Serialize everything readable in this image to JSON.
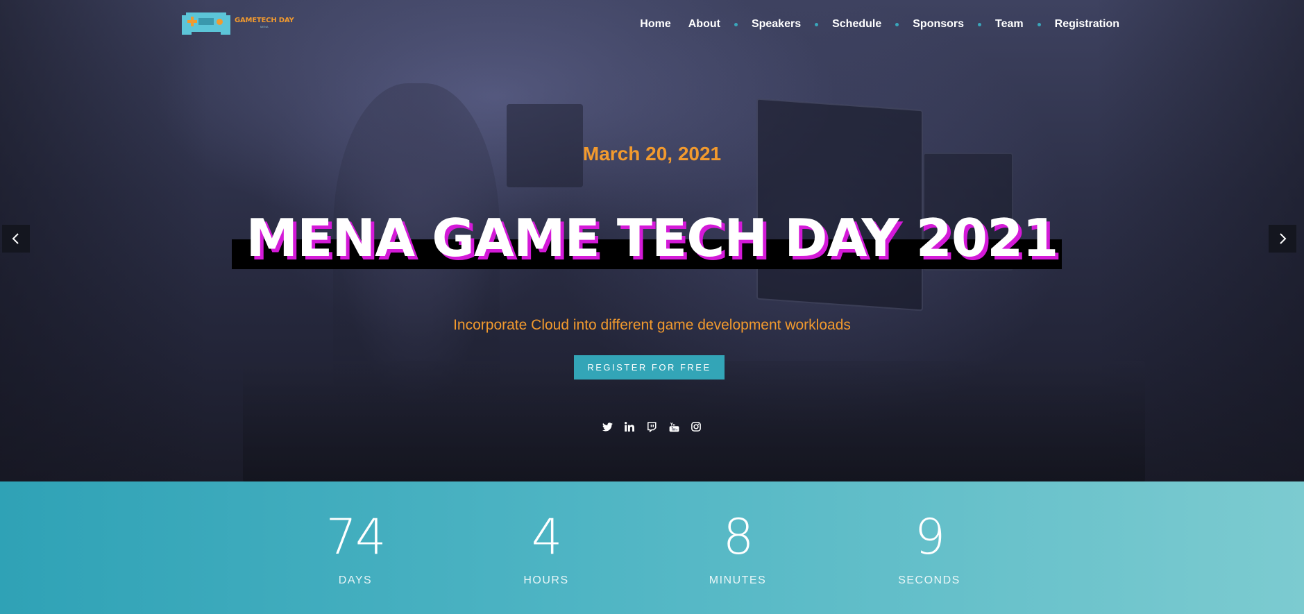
{
  "brand": {
    "logo_title": "GAMETECH DAY",
    "logo_subtitle": "MENA",
    "accent": "#f29a2e",
    "teal": "#33a5b7",
    "magenta": "#d41ad8"
  },
  "nav": {
    "items": [
      {
        "label": "Home"
      },
      {
        "label": "About"
      },
      {
        "label": "Speakers"
      },
      {
        "label": "Schedule"
      },
      {
        "label": "Sponsors"
      },
      {
        "label": "Team"
      },
      {
        "label": "Registration"
      }
    ]
  },
  "hero": {
    "date": "March 20, 2021",
    "headline": "MENA GAME TECH DAY 2021",
    "subtitle": "Incorporate Cloud into different game development workloads",
    "cta_label": "REGISTER FOR FREE",
    "social_icons": [
      "twitter-icon",
      "linkedin-icon",
      "twitch-icon",
      "youtube-icon",
      "instagram-icon"
    ],
    "prev_icon": "chevron-left-icon",
    "next_icon": "chevron-right-icon"
  },
  "countdown": {
    "days": {
      "value": "74",
      "label": "DAYS"
    },
    "hours": {
      "value": "4",
      "label": "HOURS"
    },
    "minutes": {
      "value": "8",
      "label": "MINUTES"
    },
    "seconds": {
      "value": "9",
      "label": "SECONDS"
    }
  }
}
